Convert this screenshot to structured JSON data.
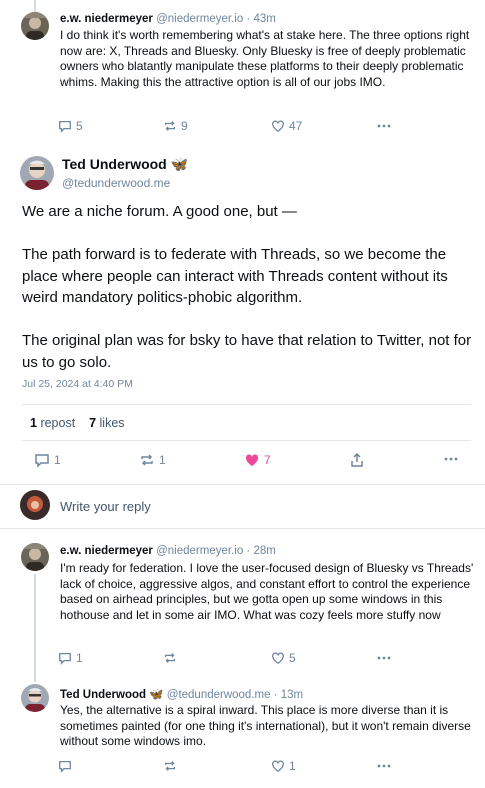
{
  "top_post": {
    "name": "e.w. niedermeyer",
    "handle": "@niedermeyer.io",
    "time": "· 43m",
    "text": "I do think it's worth remembering what's at stake here. The three options right now are: X, Threads and Bluesky. Only Bluesky is free of deeply problematic owners who blatantly manipulate these platforms to their deeply problematic whims. Making this the attractive option is all of our jobs IMO.",
    "replies": "5",
    "reposts": "9",
    "likes": "47"
  },
  "main_post": {
    "name": "Ted Underwood",
    "emoji": "🦋",
    "handle": "@tedunderwood.me",
    "paragraphs": [
      "We are a niche forum. A good one, but —",
      "The path forward is to federate with Threads, so we become the place where people can interact with Threads content without its weird mandatory politics-phobic algorithm.",
      "The original plan was for bsky to have that relation to Twitter, not for us to go solo."
    ],
    "timestamp": "Jul 25, 2024 at 4:40 PM",
    "repost_count": "1",
    "repost_label": "repost",
    "like_count": "7",
    "like_label": "likes",
    "replies": "1",
    "reposts": "1",
    "likes": "7"
  },
  "reply_box": {
    "placeholder": "Write your reply"
  },
  "reply_1": {
    "name": "e.w. niedermeyer",
    "handle": "@niedermeyer.io",
    "time": "· 28m",
    "text": "I'm ready for federation. I love the user-focused design of Bluesky vs Threads' lack of choice, aggressive algos, and constant effort to control the experience based on airhead principles, but we gotta open up some windows in this hothouse and let in some air IMO. What was cozy feels more stuffy now",
    "replies": "1",
    "reposts": "",
    "likes": "5"
  },
  "reply_2": {
    "name": "Ted Underwood",
    "emoji": "🦋",
    "handle": "@tedunderwood.me",
    "time": "· 13m",
    "text": "Yes, the alternative is a spiral inward. This place is more diverse than it is sometimes painted (for one thing it's international), but it won't remain diverse without some windows imo.",
    "replies": "",
    "reposts": "",
    "likes": "1"
  },
  "colors": {
    "text": "#0b0f14",
    "muted": "#6f869f",
    "like_active": "#ec4899",
    "divider": "#e3e8ee"
  },
  "icons": [
    "reply-icon",
    "repost-icon",
    "like-icon",
    "more-icon",
    "share-icon",
    "butterfly-icon"
  ]
}
